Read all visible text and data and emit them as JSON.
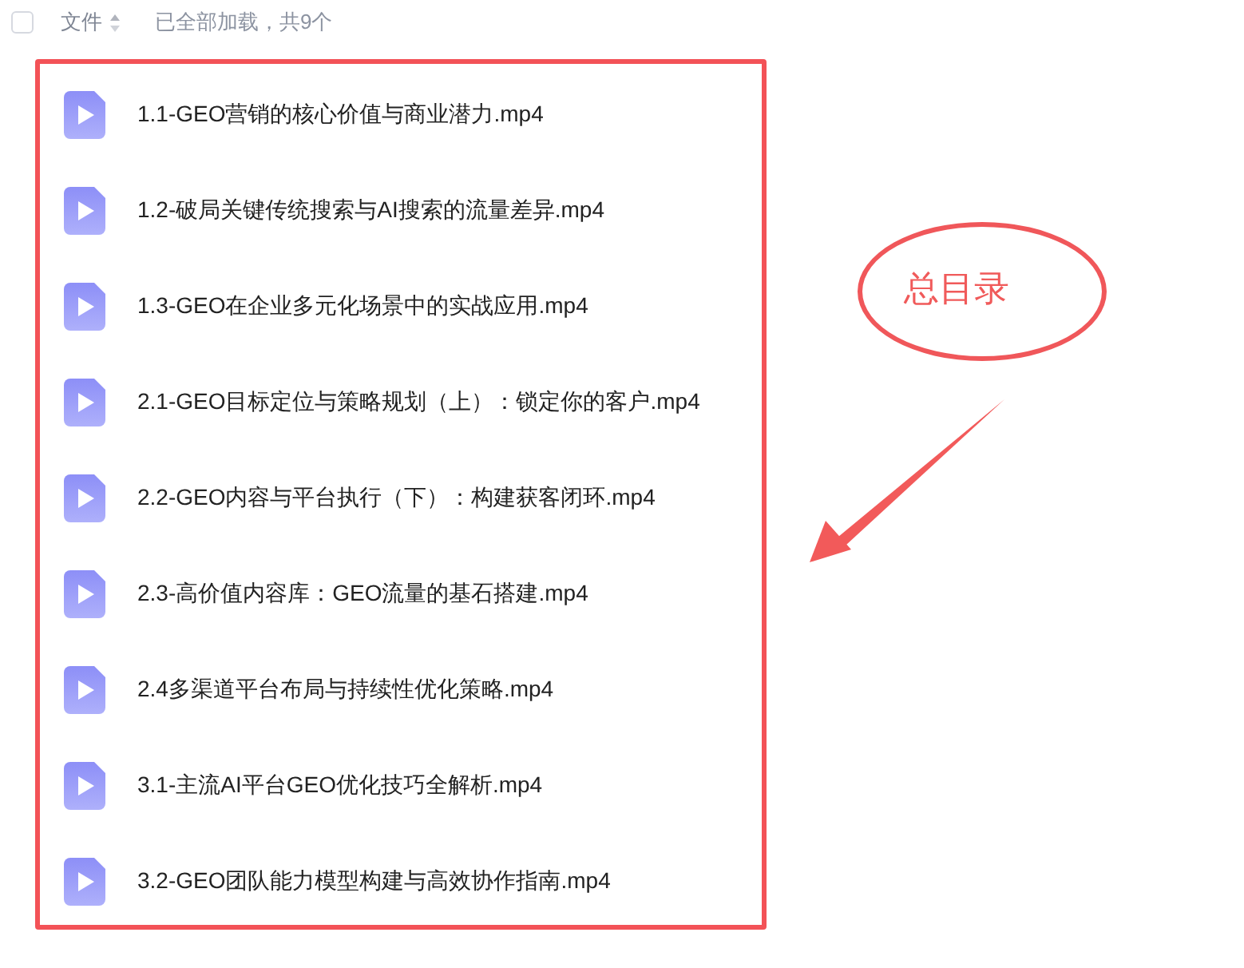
{
  "header": {
    "select_all": {
      "checked": false
    },
    "column_label": "文件",
    "status": "已全部加载，共9个"
  },
  "files": [
    {
      "name": "1.1-GEO营销的核心价值与商业潜力.mp4",
      "kind": "video"
    },
    {
      "name": "1.2-破局关键传统搜索与AI搜索的流量差异.mp4",
      "kind": "video"
    },
    {
      "name": "1.3-GEO在企业多元化场景中的实战应用.mp4",
      "kind": "video"
    },
    {
      "name": "2.1-GEO目标定位与策略规划（上）：锁定你的客户.mp4",
      "kind": "video"
    },
    {
      "name": "2.2-GEO内容与平台执行（下）：构建获客闭环.mp4",
      "kind": "video"
    },
    {
      "name": "2.3-高价值内容库：GEO流量的基石搭建.mp4",
      "kind": "video"
    },
    {
      "name": "2.4多渠道平台布局与持续性优化策略.mp4",
      "kind": "video"
    },
    {
      "name": "3.1-主流AI平台GEO优化技巧全解析.mp4",
      "kind": "video"
    },
    {
      "name": "3.2-GEO团队能力模型构建与高效协作指南.mp4",
      "kind": "video"
    }
  ],
  "annotation": {
    "label": "总目录"
  }
}
